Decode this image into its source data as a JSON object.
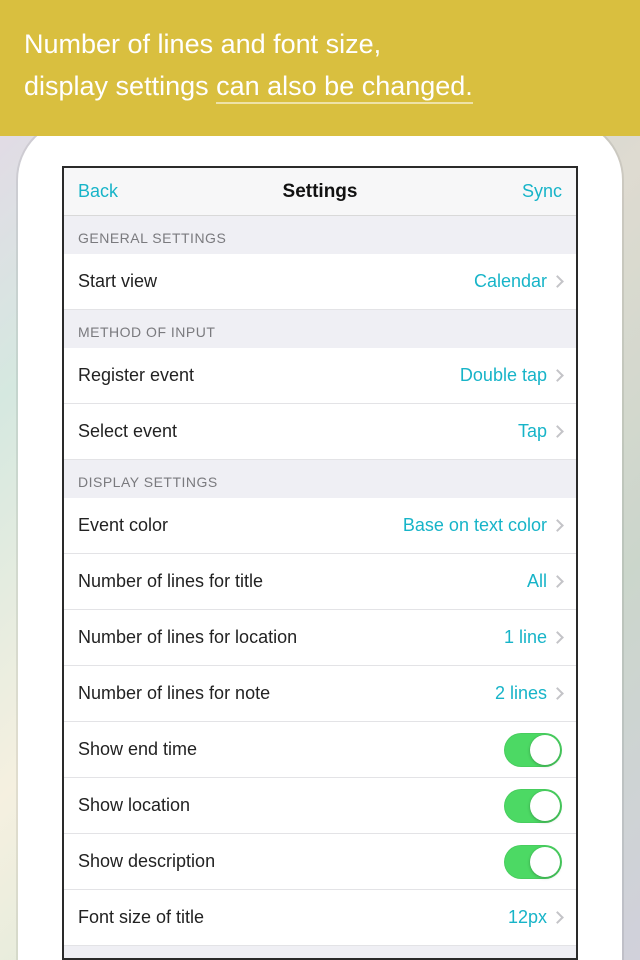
{
  "banner": {
    "line1_a": "Number of lines and font size,",
    "line2_a": "display settings ",
    "line2_b": "can also be changed."
  },
  "nav": {
    "back": "Back",
    "title": "Settings",
    "right": "Sync"
  },
  "sections": {
    "general": "GENERAL SETTINGS",
    "method": "METHOD OF INPUT",
    "display": "DISPLAY SETTINGS"
  },
  "rows": {
    "start_view": {
      "label": "Start view",
      "value": "Calendar"
    },
    "register_event": {
      "label": "Register event",
      "value": "Double tap"
    },
    "select_event": {
      "label": "Select event",
      "value": "Tap"
    },
    "event_color": {
      "label": "Event color",
      "value": "Base on text color"
    },
    "lines_title": {
      "label": "Number of lines for title",
      "value": "All"
    },
    "lines_location": {
      "label": "Number of lines for location",
      "value": "1 line"
    },
    "lines_note": {
      "label": "Number of lines for note",
      "value": "2 lines"
    },
    "show_end_time": {
      "label": "Show end time",
      "on": true
    },
    "show_location": {
      "label": "Show location",
      "on": true
    },
    "show_description": {
      "label": "Show description",
      "on": true
    },
    "font_title": {
      "label": "Font size of title",
      "value": "12px"
    }
  }
}
